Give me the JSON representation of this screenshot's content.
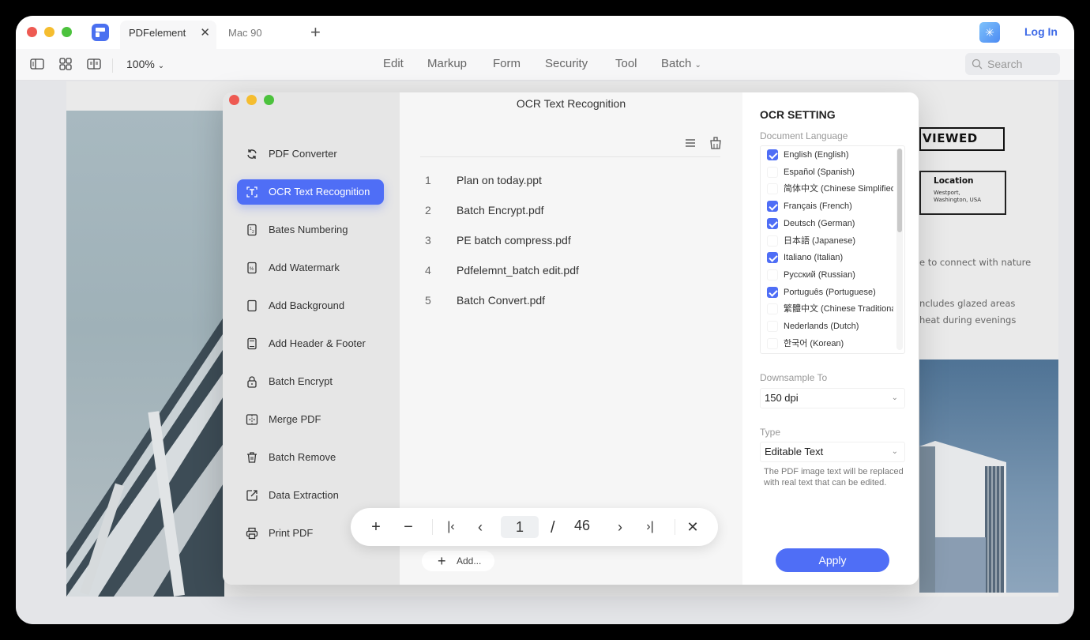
{
  "titlebar": {
    "tabs": [
      {
        "label": "PDFelement",
        "active": true
      },
      {
        "label": "Mac 90",
        "active": false
      }
    ],
    "login_label": "Log In"
  },
  "toolbar": {
    "zoom_level": "100%",
    "menu": [
      "Edit",
      "Markup",
      "Form",
      "Security",
      "Tool",
      "Batch"
    ],
    "search_placeholder": "Search"
  },
  "document": {
    "viewed": "VIEWED",
    "location_title": "Location",
    "location_line1": "Westport,",
    "location_line2": "Washington, USA",
    "text1": "e to connect with nature",
    "text2": "ncludes glazed areas",
    "text3": "heat during evenings"
  },
  "dialog": {
    "title": "OCR Text Recognition",
    "sidebar": [
      {
        "label": "PDF Converter",
        "icon": "convert-icon",
        "active": false
      },
      {
        "label": "OCR Text Recognition",
        "icon": "ocr-icon",
        "active": true
      },
      {
        "label": "Bates Numbering",
        "icon": "bates-icon",
        "active": false
      },
      {
        "label": "Add Watermark",
        "icon": "watermark-icon",
        "active": false
      },
      {
        "label": "Add Background",
        "icon": "background-icon",
        "active": false
      },
      {
        "label": "Add Header & Footer",
        "icon": "header-footer-icon",
        "active": false
      },
      {
        "label": "Batch Encrypt",
        "icon": "lock-icon",
        "active": false
      },
      {
        "label": "Merge PDF",
        "icon": "merge-icon",
        "active": false
      },
      {
        "label": "Batch Remove",
        "icon": "trash-icon",
        "active": false
      },
      {
        "label": "Data Extraction",
        "icon": "export-icon",
        "active": false
      },
      {
        "label": "Print PDF",
        "icon": "printer-icon",
        "active": false
      }
    ],
    "files": [
      {
        "num": "1",
        "name": "Plan on today.ppt"
      },
      {
        "num": "2",
        "name": "Batch Encrypt.pdf"
      },
      {
        "num": "3",
        "name": "PE batch compress.pdf"
      },
      {
        "num": "4",
        "name": "Pdfelemnt_batch edit.pdf"
      },
      {
        "num": "5",
        "name": "Batch Convert.pdf"
      }
    ],
    "add_label": "Add...",
    "settings": {
      "title": "OCR SETTING",
      "language_label": "Document Language",
      "languages": [
        {
          "label": "English (English)",
          "checked": true
        },
        {
          "label": "Español (Spanish)",
          "checked": false
        },
        {
          "label": "简体中文 (Chinese Simplified)",
          "checked": false
        },
        {
          "label": "Français (French)",
          "checked": true
        },
        {
          "label": "Deutsch (German)",
          "checked": true
        },
        {
          "label": "日本語 (Japanese)",
          "checked": false
        },
        {
          "label": "Italiano (Italian)",
          "checked": true
        },
        {
          "label": "Русский (Russian)",
          "checked": false
        },
        {
          "label": "Português (Portuguese)",
          "checked": true
        },
        {
          "label": "繁體中文 (Chinese Traditional)",
          "checked": false
        },
        {
          "label": "Nederlands (Dutch)",
          "checked": false
        },
        {
          "label": "한국어 (Korean)",
          "checked": false
        }
      ],
      "downsample_label": "Downsample To",
      "downsample_value": "150 dpi",
      "type_label": "Type",
      "type_value": "Editable Text",
      "help_text": "The PDF image text will be replaced with real text that can be edited.",
      "apply_label": "Apply"
    }
  },
  "pager": {
    "current_page": "1",
    "separator": "/",
    "total_pages": "46"
  },
  "colors": {
    "accent": "#4f6ef6",
    "link": "#3f6be7"
  }
}
